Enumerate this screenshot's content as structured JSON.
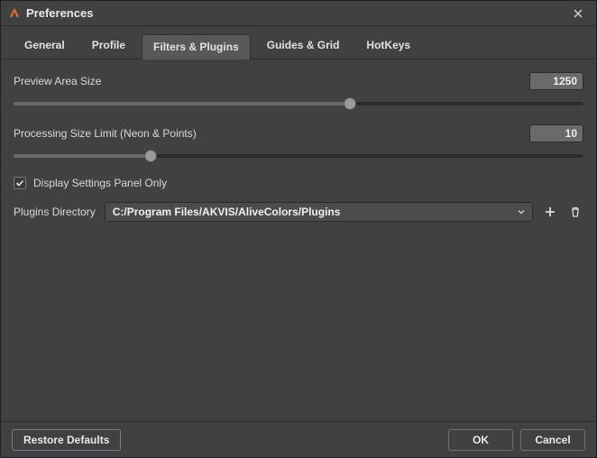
{
  "window": {
    "title": "Preferences"
  },
  "tabs": [
    {
      "label": "General"
    },
    {
      "label": "Profile"
    },
    {
      "label": "Filters & Plugins"
    },
    {
      "label": "Guides & Grid"
    },
    {
      "label": "HotKeys"
    }
  ],
  "preview_size": {
    "label": "Preview Area Size",
    "value": "1250",
    "slider_percent": 59
  },
  "processing_limit": {
    "label": "Processing Size Limit (Neon & Points)",
    "value": "10",
    "slider_percent": 24
  },
  "display_panel_only": {
    "label": "Display Settings Panel Only",
    "checked": true
  },
  "plugins_dir": {
    "label": "Plugins Directory",
    "value": "C:/Program Files/AKVIS/AliveColors/Plugins"
  },
  "buttons": {
    "restore": "Restore Defaults",
    "ok": "OK",
    "cancel": "Cancel"
  }
}
